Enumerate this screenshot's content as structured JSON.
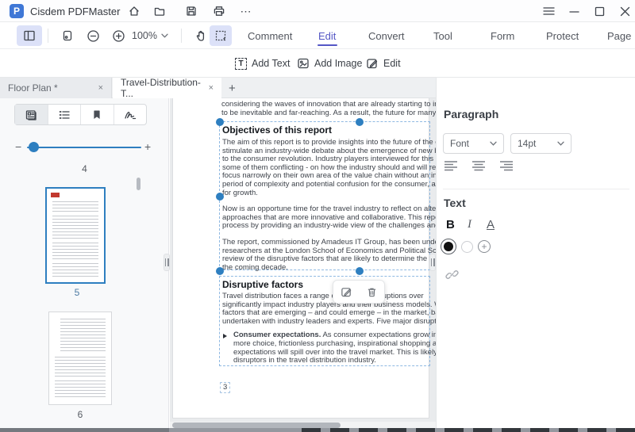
{
  "titlebar": {
    "logo_text": "P",
    "app_title": "Cisdem PDFMaster",
    "more_label": "⋯"
  },
  "toolbar": {
    "zoom_level": "100%",
    "tabs": [
      "Comment",
      "Edit",
      "Convert",
      "Tool",
      "Form",
      "Protect",
      "Page"
    ],
    "active_tab": "Edit"
  },
  "subtoolbar": {
    "add_text": "Add Text",
    "add_image": "Add Image",
    "edit": "Edit"
  },
  "tabbar": {
    "tab1": "Floor Plan *",
    "tab2": "Travel-Distribution-T...",
    "close": "×",
    "new_tab": "+"
  },
  "sidebar": {
    "slider_minus": "−",
    "slider_plus": "+",
    "current_page": "4",
    "thumb_labels": [
      "5",
      "6"
    ]
  },
  "doc": {
    "intro": [
      "considering the waves of innovation that are already starting to impact on the industry",
      "to be inevitable and far-reaching. As a result, the future for many industries will"
    ],
    "block1": {
      "heading": "Objectives of this report",
      "p1": [
        "The aim of this report is to provide insights into the future of the global travel",
        "stimulate an industry-wide debate about the emergence of new business",
        "to the consumer revolution. Industry players interviewed for this report have",
        "some of them conflicting - on how the industry should and will respond. The",
        "focus narrowly on their own area of the value chain without an industry-wide",
        "period of complexity and potential confusion for the consumer, and associated",
        "for growth."
      ],
      "p2": [
        "Now is an opportune time for the travel industry to reflect on alternative",
        "approaches that are more innovative and collaborative. This report is",
        "process by providing an industry-wide view of the challenges and opportunities"
      ],
      "p3": [
        "The report, commissioned by Amadeus IT Group, has been undertaken by",
        "researchers at the London School of Economics and Political Science (LSE)",
        "review of the disruptive factors that are likely to determine the pathways",
        "the coming decade."
      ]
    },
    "block2": {
      "heading": "Disruptive factors",
      "p1": [
        "Travel distribution faces a range of potential disruptions over",
        "significantly impact industry players and their business models. We examine",
        "factors that are emerging – and could emerge – in the market, based on",
        "undertaken with industry leaders and experts. Five major disruptive factors"
      ],
      "bullet_lead": "Consumer expectations.",
      "bullet": [
        "As consumer expectations grow in the world",
        "more choice, frictionless purchasing, inspirational shopping and",
        "expectations will spill over into the travel market. This is likely",
        "disruptors in the travel distribution industry."
      ]
    },
    "page_number": "3"
  },
  "panel": {
    "paragraph_title": "Paragraph",
    "font_value": "Font",
    "size_value": "14pt",
    "text_title": "Text",
    "bold_label": "B",
    "italic_label": "I",
    "underline_label": "A",
    "add_color_label": "+"
  },
  "colors": {
    "accent": "#5457c5",
    "selection_blue": "#2e7fc0",
    "highlight_bg": "#dce1f8",
    "logo_blue": "#3f77d6"
  }
}
